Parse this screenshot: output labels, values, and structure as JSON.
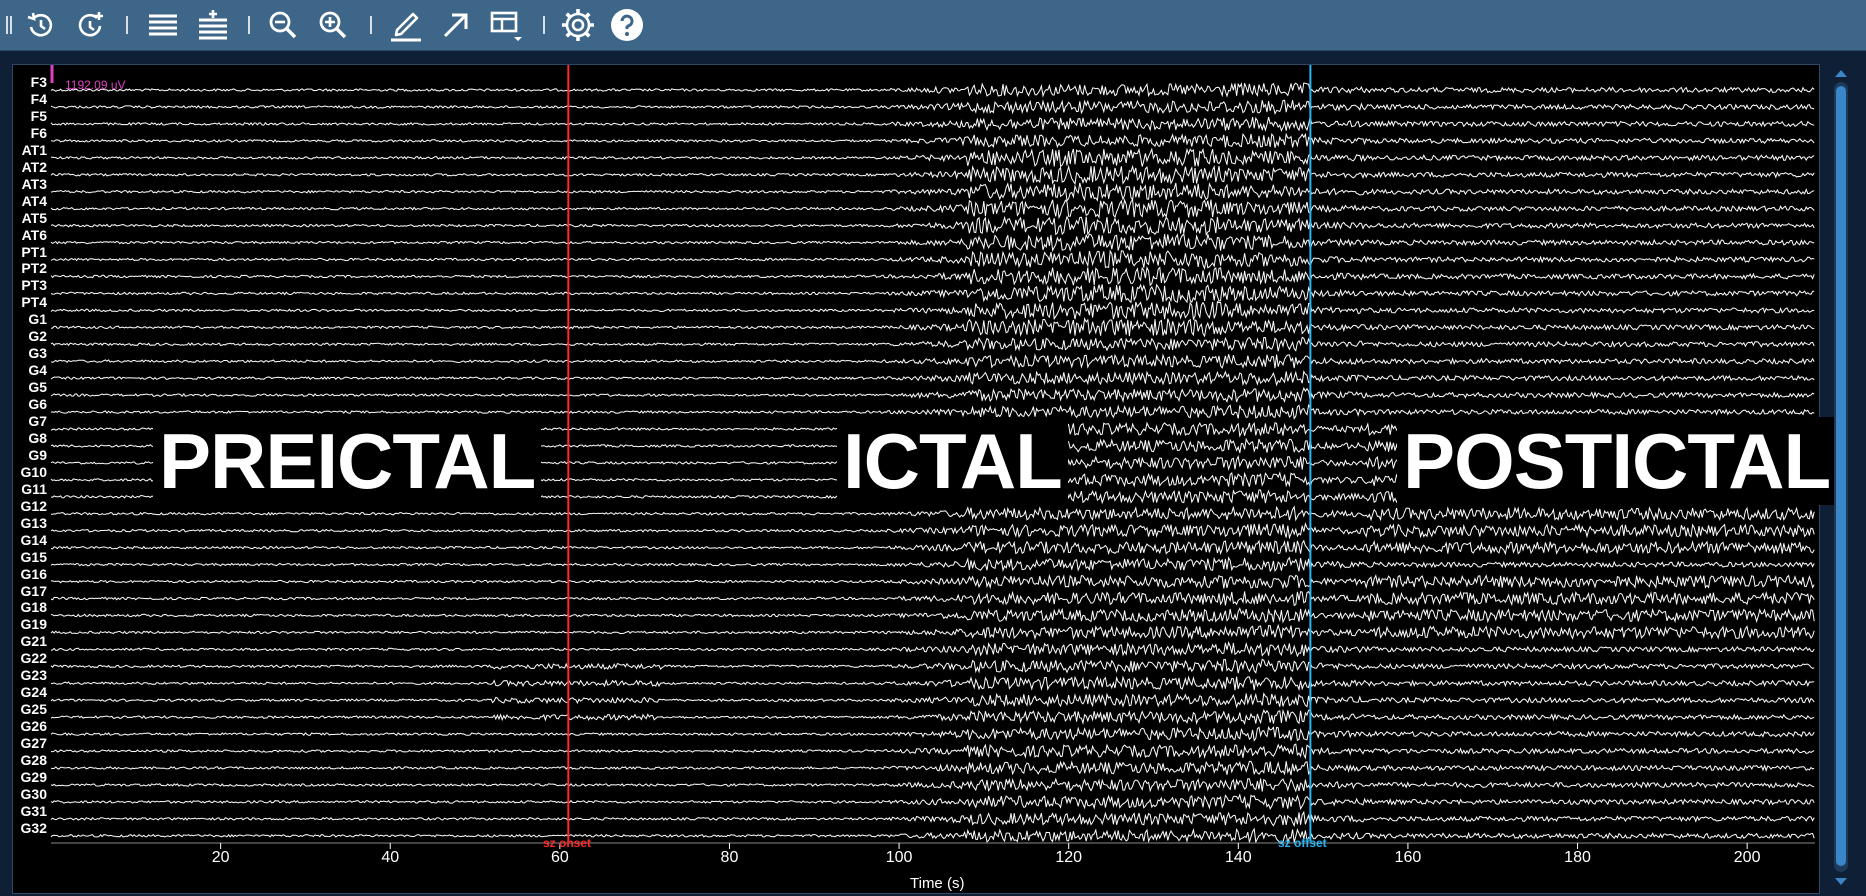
{
  "toolbar": {
    "buttons": [
      {
        "name": "history-back-icon",
        "icon": "clock-rewind"
      },
      {
        "name": "history-add-icon",
        "icon": "clock-plus"
      },
      {
        "name": "channel-list-icon",
        "icon": "list"
      },
      {
        "name": "channel-add-icon",
        "icon": "list-plus"
      },
      {
        "name": "zoom-out-icon",
        "icon": "magnifier-minus"
      },
      {
        "name": "zoom-in-icon",
        "icon": "magnifier-plus"
      },
      {
        "name": "annotate-pen-icon",
        "icon": "pen"
      },
      {
        "name": "arrow-tool-icon",
        "icon": "arrow"
      },
      {
        "name": "layout-menu-icon",
        "icon": "layout"
      },
      {
        "name": "settings-gear-icon",
        "icon": "gear"
      },
      {
        "name": "help-icon",
        "icon": "question"
      }
    ],
    "colors": {
      "bar": "#3e6688",
      "icon": "#ffffff"
    }
  },
  "plot": {
    "channels": [
      "F3",
      "F4",
      "F5",
      "F6",
      "AT1",
      "AT2",
      "AT3",
      "AT4",
      "AT5",
      "AT6",
      "PT1",
      "PT2",
      "PT3",
      "PT4",
      "G1",
      "G2",
      "G3",
      "G4",
      "G5",
      "G6",
      "G7",
      "G8",
      "G9",
      "G10",
      "G11",
      "G12",
      "G13",
      "G14",
      "G15",
      "G16",
      "G17",
      "G18",
      "G19",
      "G21",
      "G22",
      "G23",
      "G24",
      "G25",
      "G26",
      "G27",
      "G28",
      "G29",
      "G30",
      "G31",
      "G32"
    ],
    "x_ticks": [
      "20",
      "40",
      "60",
      "80",
      "100",
      "120",
      "140",
      "160",
      "180",
      "200"
    ],
    "x_tick_values": [
      20,
      40,
      60,
      80,
      100,
      120,
      140,
      160,
      180,
      200
    ],
    "x_range": [
      0,
      208
    ],
    "x_axis_label": "Time (s)",
    "scale_label": "1192.09 uV",
    "phases": [
      "PREICTAL",
      "ICTAL",
      "POSTICTAL"
    ],
    "markers": [
      {
        "label": "sz onset",
        "time": 61,
        "color": "#ff2a2a"
      },
      {
        "label": "sz offset",
        "time": 148.5,
        "color": "#29b6f6"
      }
    ],
    "colors": {
      "background": "#000000",
      "trace": "#ffffff",
      "scale": "#e040c0"
    }
  }
}
